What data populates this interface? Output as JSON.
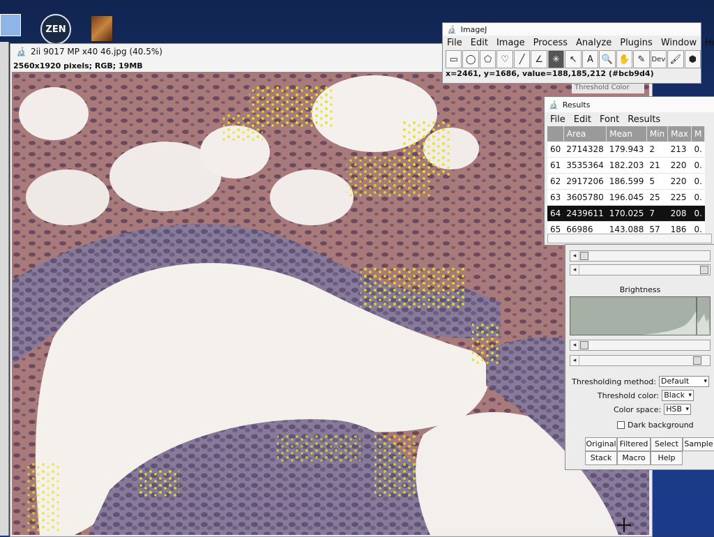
{
  "desktop": {
    "zen_label": "ZEN"
  },
  "image_window": {
    "title": "2ii 9017 MP x40 46.jpg (40.5%)",
    "info": "2560x1920 pixels; RGB; 19MB"
  },
  "imagej": {
    "title": "ImageJ",
    "menu": [
      "File",
      "Edit",
      "Image",
      "Process",
      "Analyze",
      "Plugins",
      "Window",
      "Help"
    ],
    "tools": [
      {
        "name": "rectangle-tool-icon",
        "glyph": "▭"
      },
      {
        "name": "oval-tool-icon",
        "glyph": "◯"
      },
      {
        "name": "polygon-tool-icon",
        "glyph": "⬠"
      },
      {
        "name": "freehand-tool-icon",
        "glyph": "♡"
      },
      {
        "name": "line-tool-icon",
        "glyph": "╱"
      },
      {
        "name": "angle-tool-icon",
        "glyph": "∠"
      },
      {
        "name": "point-tool-icon",
        "glyph": "✳"
      },
      {
        "name": "wand-tool-icon",
        "glyph": "↖"
      },
      {
        "name": "text-tool-icon",
        "glyph": "A"
      },
      {
        "name": "magnifier-tool-icon",
        "glyph": "🔍"
      },
      {
        "name": "hand-tool-icon",
        "glyph": "✋"
      },
      {
        "name": "dropper-tool-icon",
        "glyph": "✎"
      },
      {
        "name": "dev-tool-icon",
        "glyph": "Dev"
      },
      {
        "name": "brush-tool-icon",
        "glyph": "🖌"
      },
      {
        "name": "flood-fill-tool-icon",
        "glyph": "⬢"
      }
    ],
    "status": "x=2461, y=1686, value=188,185,212 (#bcb9d4)"
  },
  "results": {
    "title": "Results",
    "menu": [
      "File",
      "Edit",
      "Font",
      "Results"
    ],
    "columns": [
      "",
      "Area",
      "Mean",
      "Min",
      "Max",
      "M"
    ],
    "rows": [
      [
        "60",
        "2714328",
        "179.943",
        "2",
        "213",
        "0."
      ],
      [
        "61",
        "3535364",
        "182.203",
        "21",
        "220",
        "0."
      ],
      [
        "62",
        "2917206",
        "186.599",
        "5",
        "220",
        "0."
      ],
      [
        "63",
        "3605780",
        "196.045",
        "25",
        "225",
        "0."
      ],
      [
        "64",
        "2439611",
        "170.025",
        "7",
        "208",
        "0."
      ],
      [
        "65",
        "66986",
        "143.088",
        "57",
        "186",
        "0."
      ]
    ],
    "selected_row": 4
  },
  "threshold": {
    "tab_title": "Threshold Color",
    "brightness_label": "Brightness",
    "thresholding_method_label": "Thresholding method:",
    "thresholding_method_value": "Default",
    "threshold_color_label": "Threshold color:",
    "threshold_color_value": "Black",
    "color_space_label": "Color space:",
    "color_space_value": "HSB",
    "dark_background_label": "Dark background",
    "buttons_row1": [
      "Original",
      "Filtered",
      "Select",
      "Sample"
    ],
    "buttons_row2": [
      "Stack",
      "Macro",
      "Help"
    ]
  }
}
